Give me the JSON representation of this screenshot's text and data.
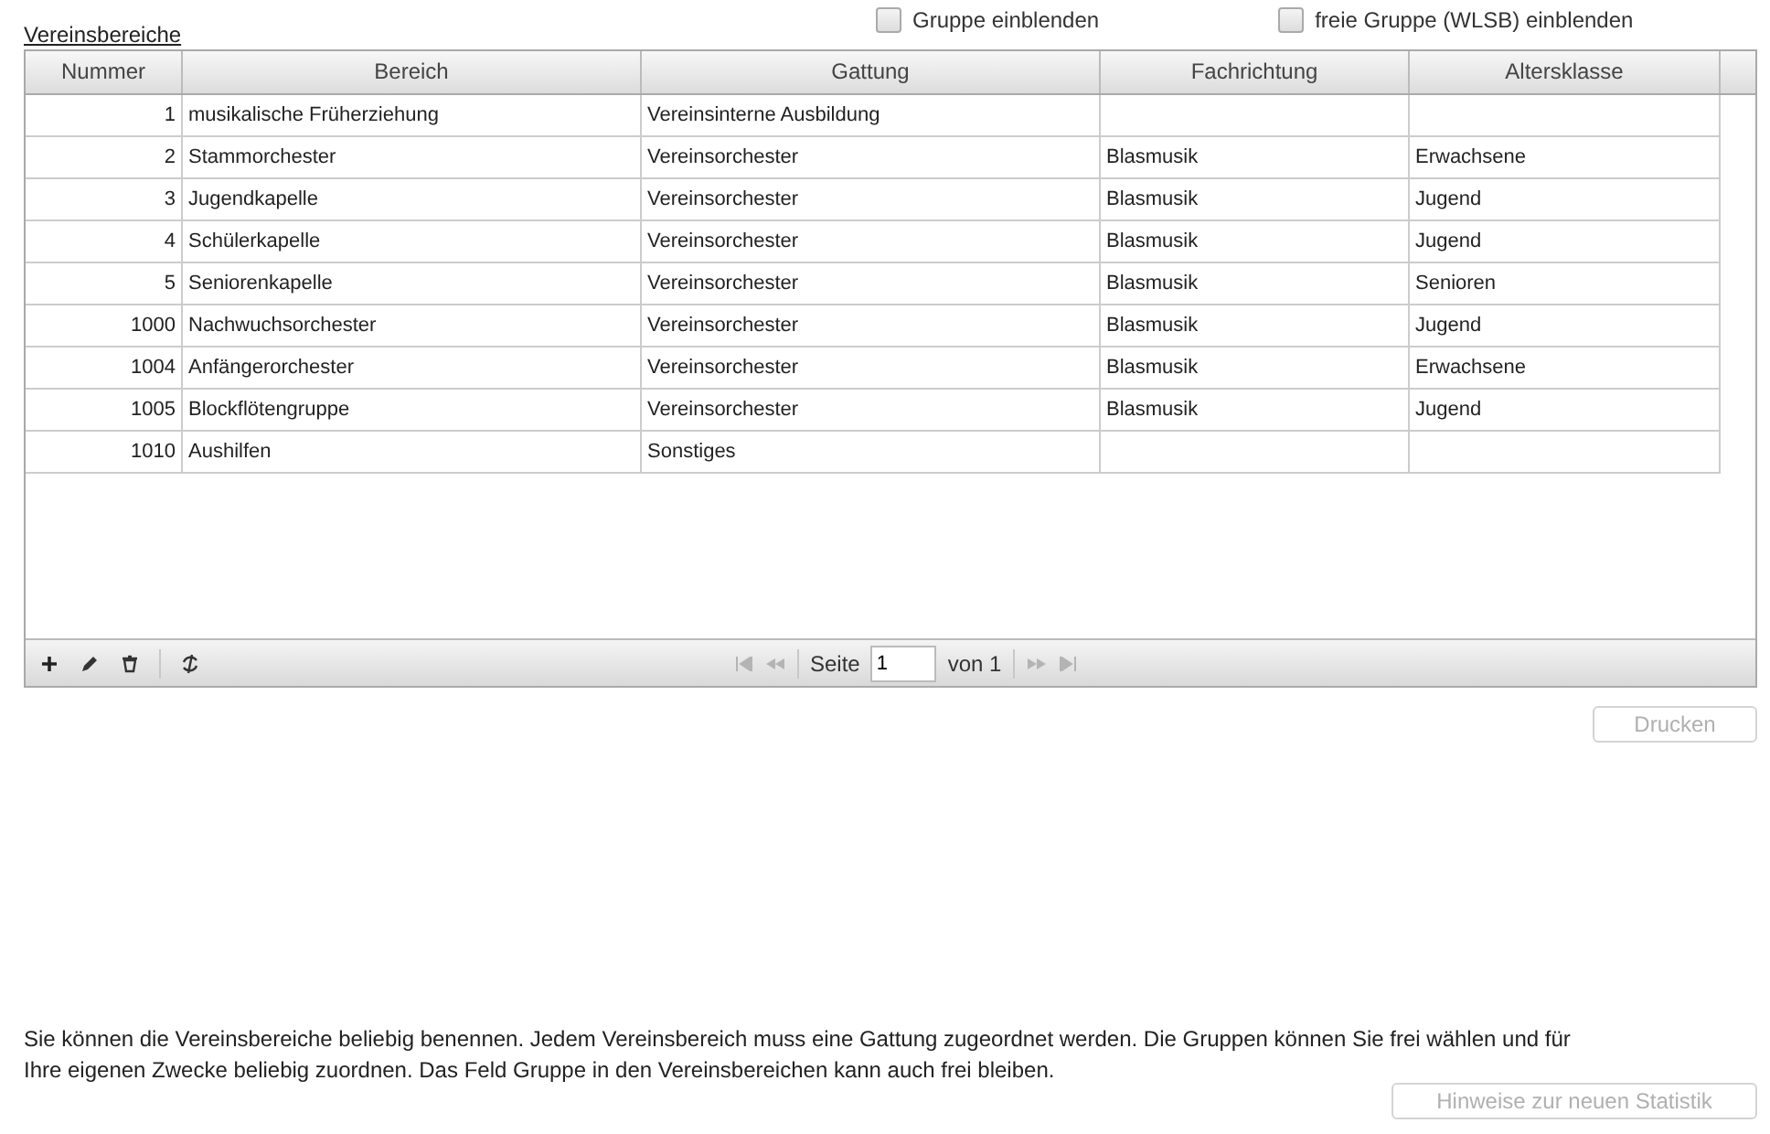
{
  "title_link": "Vereinsbereiche",
  "toggles": [
    {
      "label": "Gruppe einblenden",
      "checked": false
    },
    {
      "label": "freie Gruppe (WLSB) einblenden",
      "checked": false
    }
  ],
  "table": {
    "columns": [
      "Nummer",
      "Bereich",
      "Gattung",
      "Fachrichtung",
      "Altersklasse"
    ],
    "rows": [
      [
        "1",
        "musikalische Früherziehung",
        "Vereinsinterne Ausbildung",
        "",
        ""
      ],
      [
        "2",
        "Stammorchester",
        "Vereinsorchester",
        "Blasmusik",
        "Erwachsene"
      ],
      [
        "3",
        "Jugendkapelle",
        "Vereinsorchester",
        "Blasmusik",
        "Jugend"
      ],
      [
        "4",
        "Schülerkapelle",
        "Vereinsorchester",
        "Blasmusik",
        "Jugend"
      ],
      [
        "5",
        "Seniorenkapelle",
        "Vereinsorchester",
        "Blasmusik",
        "Senioren"
      ],
      [
        "1000",
        "Nachwuchsorchester",
        "Vereinsorchester",
        "Blasmusik",
        "Jugend"
      ],
      [
        "1004",
        "Anfängerorchester",
        "Vereinsorchester",
        "Blasmusik",
        "Erwachsene"
      ],
      [
        "1005",
        "Blockflötengruppe",
        "Vereinsorchester",
        "Blasmusik",
        "Jugend"
      ],
      [
        "1010",
        "Aushilfen",
        "Sonstiges",
        "",
        ""
      ]
    ]
  },
  "pager": {
    "page_label": "Seite",
    "page": "1",
    "of_label": "von 1",
    "nav_disabled": true
  },
  "print_button": {
    "label": "Drucken",
    "disabled": true
  },
  "info_text": "Sie können die Vereinsbereiche beliebig benennen. Jedem Vereinsbereich muss eine Gattung zugeordnet werden. Die Gruppen können Sie frei wählen und für Ihre eigenen Zwecke beliebig zuordnen. Das Feld Gruppe in den Vereinsbereichen kann auch frei bleiben.",
  "hint_button": {
    "label": "Hinweise zur neuen Statistik",
    "disabled": true
  }
}
